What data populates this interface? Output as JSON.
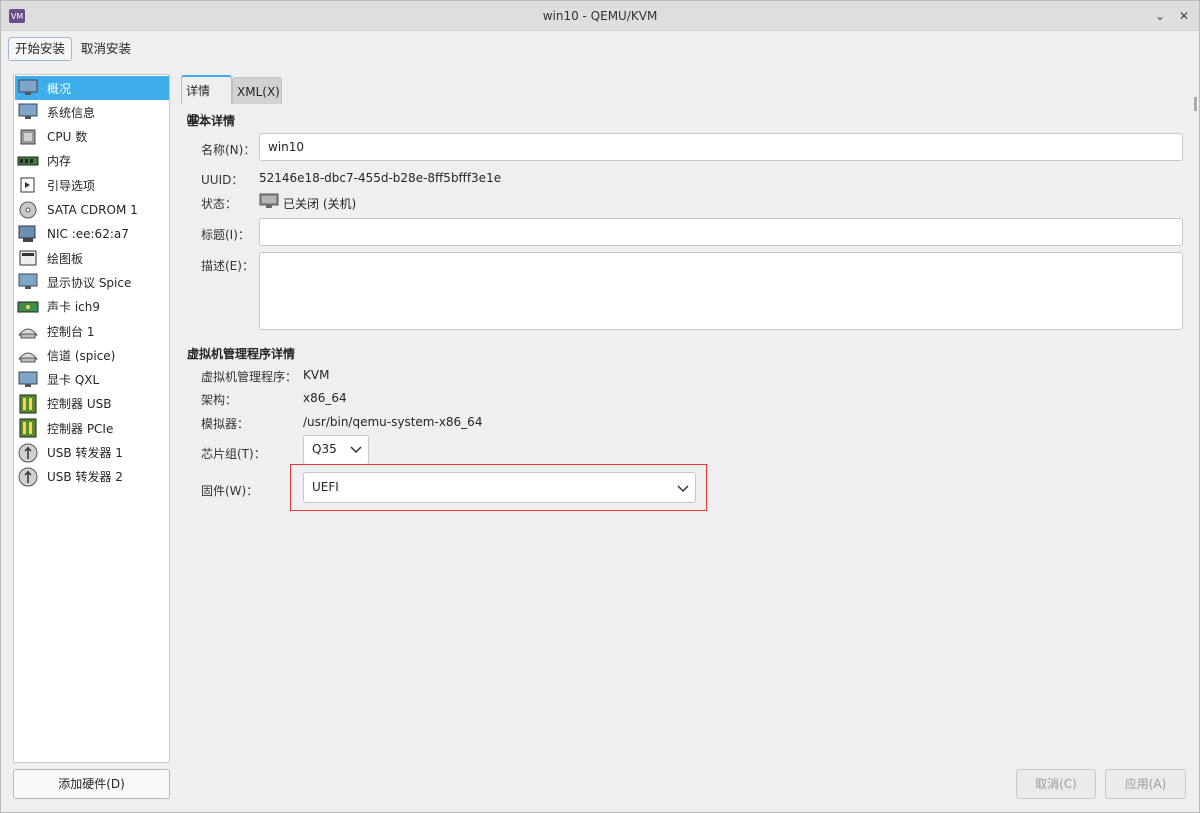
{
  "window": {
    "title": "win10 - QEMU/KVM",
    "minimize_glyph": "⌄",
    "close_glyph": "✕"
  },
  "toolbar": {
    "begin_install": "开始安装",
    "cancel_install": "取消安装"
  },
  "sidebar": {
    "items": [
      {
        "label": "概况",
        "icon": "overview-monitor-icon"
      },
      {
        "label": "系统信息",
        "icon": "system-info-monitor-icon"
      },
      {
        "label": "CPU 数",
        "icon": "cpu-chip-icon"
      },
      {
        "label": "内存",
        "icon": "memory-ram-icon"
      },
      {
        "label": "引导选项",
        "icon": "boot-options-icon"
      },
      {
        "label": "SATA CDROM 1",
        "icon": "cdrom-disc-icon"
      },
      {
        "label": "NIC :ee:62:a7",
        "icon": "network-card-icon"
      },
      {
        "label": "绘图板",
        "icon": "tablet-icon"
      },
      {
        "label": "显示协议 Spice",
        "icon": "display-monitor-icon"
      },
      {
        "label": "声卡 ich9",
        "icon": "sound-card-icon"
      },
      {
        "label": "控制台 1",
        "icon": "console-serial-icon"
      },
      {
        "label": "信道 (spice)",
        "icon": "channel-serial-icon"
      },
      {
        "label": "显卡 QXL",
        "icon": "video-card-icon"
      },
      {
        "label": "控制器 USB",
        "icon": "usb-controller-icon"
      },
      {
        "label": "控制器 PCIe",
        "icon": "pcie-controller-icon"
      },
      {
        "label": "USB 转发器 1",
        "icon": "usb-redirector-icon"
      },
      {
        "label": "USB 转发器 2",
        "icon": "usb-redirector-icon"
      }
    ],
    "add_hardware": "添加硬件(D)"
  },
  "tabs": {
    "details": "详情(D)",
    "xml": "XML(X)"
  },
  "basic": {
    "heading": "基本详情",
    "name_label": "名称(N)：",
    "name_value": "win10",
    "uuid_label": "UUID：",
    "uuid_value": "52146e18-dbc7-455d-b28e-8ff5bfff3e1e",
    "status_label": "状态：",
    "status_value": "已关闭 (关机)",
    "title_label": "标题(I)：",
    "title_value": "",
    "desc_label": "描述(E)：",
    "desc_value": ""
  },
  "hypervisor": {
    "heading": "虚拟机管理程序详情",
    "hv_label": "虚拟机管理程序：",
    "hv_value": "KVM",
    "arch_label": "架构：",
    "arch_value": "x86_64",
    "emu_label": "模拟器：",
    "emu_value": "/usr/bin/qemu-system-x86_64",
    "chipset_label": "芯片组(T)：",
    "chipset_value": "Q35",
    "firmware_label": "固件(W)：",
    "firmware_value": "UEFI"
  },
  "footer": {
    "cancel": "取消(C)",
    "apply": "应用(A)"
  },
  "colors": {
    "selection": "#3daee9",
    "highlight_box": "#e53935"
  }
}
